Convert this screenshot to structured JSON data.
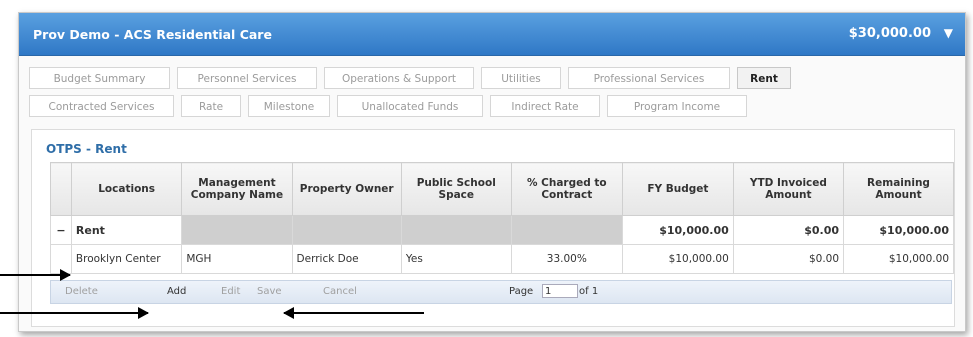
{
  "header": {
    "title": "Prov Demo - ACS Residential Care",
    "amount": "$30,000.00",
    "chevron": "▼"
  },
  "tabs": {
    "row1": [
      "Budget Summary",
      "Personnel Services",
      "Operations & Support",
      "Utilities",
      "Professional Services",
      "Rent"
    ],
    "row2": [
      "Contracted Services",
      "Rate",
      "Milestone",
      "Unallocated Funds",
      "Indirect Rate",
      "Program Income"
    ],
    "active": "Rent"
  },
  "section": {
    "title": "OTPS - Rent"
  },
  "table": {
    "columns": [
      "Locations",
      "Management Company Name",
      "Property Owner",
      "Public School Space",
      "% Charged to Contract",
      "FY Budget",
      "YTD Invoiced Amount",
      "Remaining Amount"
    ],
    "group": {
      "toggle": "−",
      "label": "Rent",
      "fy_budget": "$10,000.00",
      "ytd": "$0.00",
      "remaining": "$10,000.00"
    },
    "rows": [
      {
        "location": "Brooklyn Center",
        "mgmt": "MGH",
        "owner": "Derrick Doe",
        "school": "Yes",
        "pct": "33.00%",
        "fy_budget": "$10,000.00",
        "ytd": "$0.00",
        "remaining": "$10,000.00"
      }
    ]
  },
  "pager": {
    "delete": "Delete",
    "add": "Add",
    "edit": "Edit",
    "save": "Save",
    "cancel": "Cancel",
    "page_label": "Page",
    "page_value": "1",
    "of_label": "of 1"
  }
}
